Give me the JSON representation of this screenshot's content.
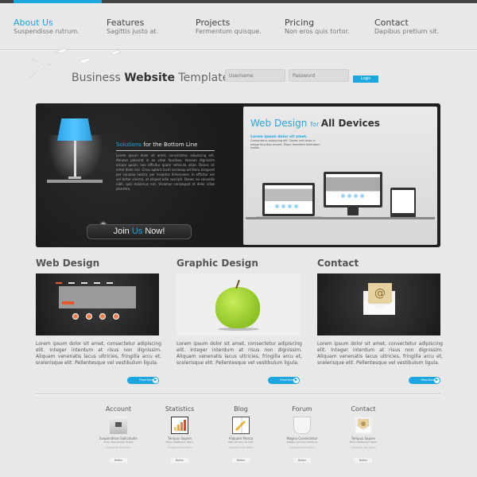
{
  "colors": {
    "accent": "#1ba6e0",
    "dark_panel": "#1e1e1e",
    "background": "#e8e8e8",
    "orange": "#e85a2e"
  },
  "nav": [
    {
      "title": "About Us",
      "subtitle": "Suspendisse rutrum.",
      "active": true
    },
    {
      "title": "Features",
      "subtitle": "Sagittis justo at.",
      "active": false
    },
    {
      "title": "Projects",
      "subtitle": "Fermentum quisque.",
      "active": false
    },
    {
      "title": "Pricing",
      "subtitle": "Non eros quis tortor.",
      "active": false
    },
    {
      "title": "Contact",
      "subtitle": "Dapibus pretium sit.",
      "active": false
    }
  ],
  "brand": {
    "part1": "Business ",
    "part2": "Website",
    "part3": " Template"
  },
  "login": {
    "username_placeholder": "Username",
    "password_placeholder": "Password",
    "button": "Login"
  },
  "hero": {
    "solutions_highlight": "Solutions",
    "solutions_rest": " for the Bottom Line",
    "solutions_body": "Lorem ipsum dolor sit amet, consectetur adipiscing elit. Aenean placerat in ex vitae faucibus. Aenean dignissim ornare quam, non efficitur quam vehicula vitae. Donec sit amet diam nisi. Class aptent taciti sociosqu ad litora torquent per conubia nostra, per inceptos himenaeos. In efficitur est vel tortor viverra, at aliquet odio suscipit. Donec eu convallis nibh, quis maximus nisi. Vivamus consequat at dolor vitae pharetra.",
    "join_part1": "Join ",
    "join_part2": "Us",
    "join_part3": " Now!",
    "webdesign_title": "Web Design ",
    "webdesign_for": "for ",
    "webdesign_bold": "All Devices",
    "webdesign_sub": "Lorem ipsum dolor sit amet.",
    "webdesign_body": "Consectetur adipiscing elit. Donec sed dolor in neque faucibus ornare. Etiam hendrerit bibendum mattis."
  },
  "sections": [
    {
      "title": "Web Design",
      "body": "Lorem ipsum dolor sit amet, consectetur adipiscing elit. Integer interdum at risus non dignissim. Aliquam venenatis lacus ultricies, fringilla arcu et, scelerisque elit. Pellentesque vel vestibulum ligula.",
      "button": "Read More",
      "image": "website-mockup"
    },
    {
      "title": "Graphic Design",
      "body": "Lorem ipsum dolor sit amet, consectetur adipiscing elit. Integer interdum at risus non dignissim. Aliquam venenatis lacus ultricies, fringilla arcu et, scelerisque elit. Pellentesque vel vestibulum ligula.",
      "button": "Read More",
      "image": "green-apple"
    },
    {
      "title": "Contact",
      "body": "Lorem ipsum dolor sit amet, consectetur adipiscing elit. Integer interdum at risus non dignissim. Aliquam venenatis lacus ultricies, fringilla arcu et, scelerisque elit. Pellentesque vel vestibulum ligula.",
      "button": "Read More",
      "image": "email-envelope"
    }
  ],
  "features": [
    {
      "title": "Account",
      "icon": "safe-icon",
      "line1": "Suspendisse Sollicitudin",
      "line2": "Duis vitae semper turpis",
      "line3": "Vivamus dui diam",
      "button": "Button"
    },
    {
      "title": "Statistics",
      "icon": "chart-monitor-icon",
      "line1": "Tempus Sapien",
      "line2": "Nunc vestibulum libero",
      "line3": "Vivamus dui diam",
      "button": "Button"
    },
    {
      "title": "Blog",
      "icon": "notebook-pencil-icon",
      "line1": "Aliquam Massa",
      "line2": "Nam et rhoncus odio",
      "line3": "Vivamus dui diam",
      "button": "Button"
    },
    {
      "title": "Forum",
      "icon": "coffee-cup-icon",
      "line1": "Magna Consectetur",
      "line2": "Integer nisi sem maximus",
      "line3": "Vivamus dui diam",
      "button": "Button"
    },
    {
      "title": "Contact",
      "icon": "mail-envelope-icon",
      "line1": "Tempus Sapien",
      "line2": "Nunc vestibulum libero",
      "line3": "Vivamus dui diam",
      "button": "Button"
    }
  ]
}
